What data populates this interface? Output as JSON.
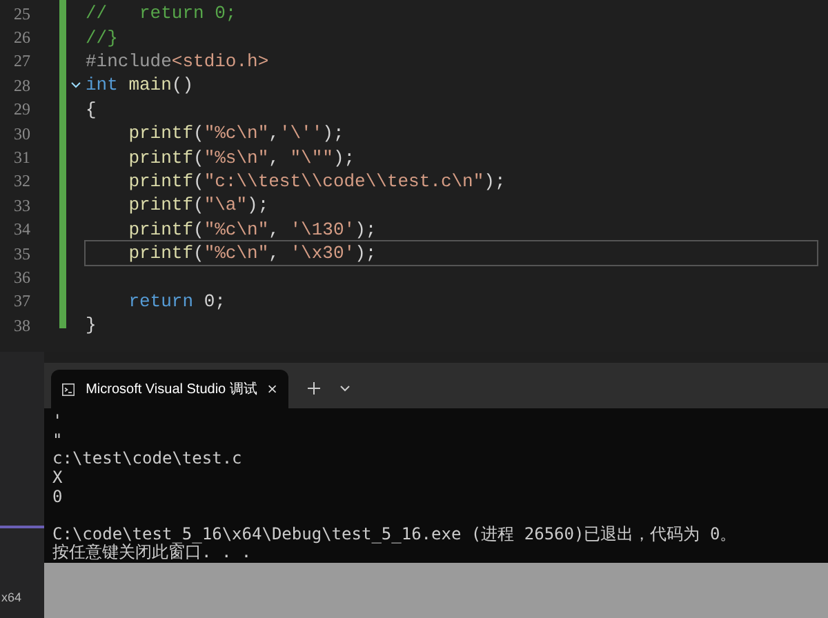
{
  "editor": {
    "lines": [
      {
        "number": "25",
        "current": false,
        "fold": false,
        "segments": [
          {
            "kind": "comment",
            "text": "//   return 0;"
          }
        ]
      },
      {
        "number": "26",
        "current": false,
        "fold": false,
        "segments": [
          {
            "kind": "comment",
            "text": "//}"
          }
        ]
      },
      {
        "number": "27",
        "current": false,
        "fold": false,
        "segments": [
          {
            "kind": "preproc",
            "text": "#include"
          },
          {
            "kind": "string",
            "text": "<stdio.h>"
          }
        ]
      },
      {
        "number": "28",
        "current": false,
        "fold": true,
        "segments": [
          {
            "kind": "keyword",
            "text": "int"
          },
          {
            "kind": "function",
            "text": " main"
          },
          {
            "kind": "plain",
            "text": "()"
          }
        ]
      },
      {
        "number": "29",
        "current": false,
        "fold": false,
        "segments": [
          {
            "kind": "plain",
            "text": "{"
          }
        ]
      },
      {
        "number": "30",
        "current": false,
        "fold": false,
        "segments": [
          {
            "kind": "function",
            "text": "    printf"
          },
          {
            "kind": "plain",
            "text": "("
          },
          {
            "kind": "string",
            "text": "\"%c\\n\""
          },
          {
            "kind": "plain",
            "text": ","
          },
          {
            "kind": "string",
            "text": "'\\''"
          },
          {
            "kind": "plain",
            "text": ");"
          }
        ]
      },
      {
        "number": "31",
        "current": false,
        "fold": false,
        "segments": [
          {
            "kind": "function",
            "text": "    printf"
          },
          {
            "kind": "plain",
            "text": "("
          },
          {
            "kind": "string",
            "text": "\"%s\\n\""
          },
          {
            "kind": "plain",
            "text": ", "
          },
          {
            "kind": "string",
            "text": "\"\\\"\""
          },
          {
            "kind": "plain",
            "text": ");"
          }
        ]
      },
      {
        "number": "32",
        "current": false,
        "fold": false,
        "segments": [
          {
            "kind": "function",
            "text": "    printf"
          },
          {
            "kind": "plain",
            "text": "("
          },
          {
            "kind": "string",
            "text": "\"c:\\\\test\\\\code\\\\test.c\\n\""
          },
          {
            "kind": "plain",
            "text": ");"
          }
        ]
      },
      {
        "number": "33",
        "current": false,
        "fold": false,
        "segments": [
          {
            "kind": "function",
            "text": "    printf"
          },
          {
            "kind": "plain",
            "text": "("
          },
          {
            "kind": "string",
            "text": "\"\\a\""
          },
          {
            "kind": "plain",
            "text": ");"
          }
        ]
      },
      {
        "number": "34",
        "current": false,
        "fold": false,
        "segments": [
          {
            "kind": "function",
            "text": "    printf"
          },
          {
            "kind": "plain",
            "text": "("
          },
          {
            "kind": "string",
            "text": "\"%c\\n\""
          },
          {
            "kind": "plain",
            "text": ", "
          },
          {
            "kind": "string",
            "text": "'\\130'"
          },
          {
            "kind": "plain",
            "text": ");"
          }
        ]
      },
      {
        "number": "35",
        "current": true,
        "fold": false,
        "segments": [
          {
            "kind": "function",
            "text": "    printf"
          },
          {
            "kind": "plain",
            "text": "("
          },
          {
            "kind": "string",
            "text": "\"%c\\n\""
          },
          {
            "kind": "plain",
            "text": ", "
          },
          {
            "kind": "string",
            "text": "'\\x30'"
          },
          {
            "kind": "plain",
            "text": ");"
          }
        ]
      },
      {
        "number": "36",
        "current": false,
        "fold": false
      },
      {
        "number": "37",
        "current": false,
        "fold": false,
        "segments": [
          {
            "kind": "keyword",
            "text": "    return"
          },
          {
            "kind": "plain",
            "text": " 0;"
          }
        ]
      },
      {
        "number": "38",
        "current": false,
        "fold": false,
        "segments": [
          {
            "kind": "plain",
            "text": "}"
          }
        ]
      }
    ]
  },
  "side_label": "x64",
  "terminal": {
    "tab": {
      "title": "Microsoft Visual Studio 调试"
    },
    "output_blocks": [
      [
        "'",
        "\"",
        "c:\\test\\code\\test.c",
        "X",
        "0"
      ],
      [
        "C:\\code\\test_5_16\\x64\\Debug\\test_5_16.exe (进程 26560)已退出，代码为 0。",
        "按任意键关闭此窗口. . ."
      ]
    ]
  }
}
